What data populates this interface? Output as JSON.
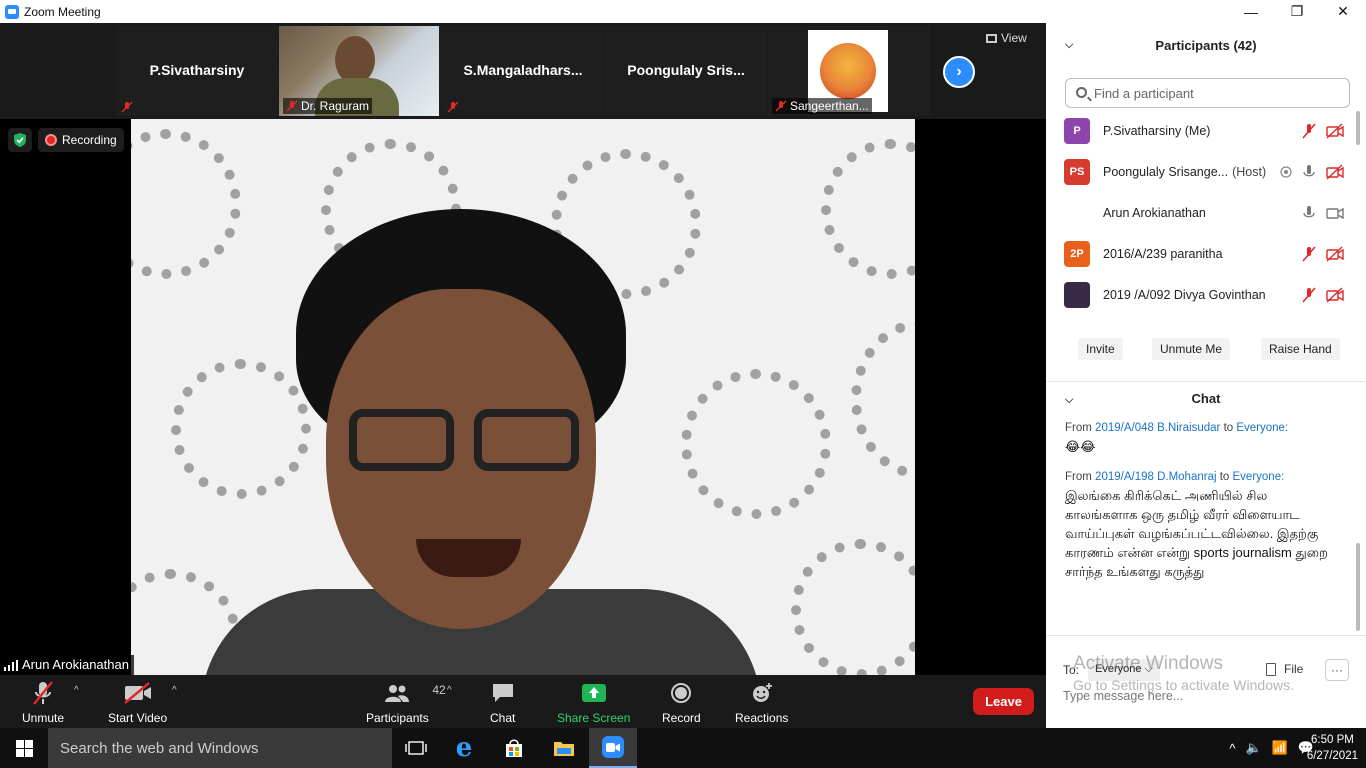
{
  "window": {
    "title": "Zoom Meeting",
    "minimize": "—",
    "maximize": "❐",
    "close": "✕"
  },
  "thumbnails": [
    {
      "name": "P.Sivatharsiny"
    },
    {
      "name": "Dr. Raguram"
    },
    {
      "name": "S.Mangaladhars..."
    },
    {
      "name": "Poongulaly  Sris..."
    },
    {
      "name": "Sangeerthan..."
    }
  ],
  "view_label": "View",
  "recording_label": "Recording",
  "active_speaker": "Arun Arokianathan",
  "toolbar": {
    "unmute": "Unmute",
    "start_video": "Start Video",
    "participants": "Participants",
    "participants_count": "42",
    "chat": "Chat",
    "share_screen": "Share Screen",
    "record": "Record",
    "reactions": "Reactions",
    "leave": "Leave"
  },
  "participants_panel": {
    "title": "Participants (42)",
    "search_placeholder": "Find a participant",
    "list": [
      {
        "initials": "P",
        "name": "P.Sivatharsiny (Me)",
        "avatar_color": "#8e44ad",
        "host": ""
      },
      {
        "initials": "PS",
        "name": "Poongulaly Srisange...",
        "avatar_color": "#d63b2f",
        "host": "(Host)"
      },
      {
        "initials": "",
        "name": "Arun Arokianathan",
        "avatar_color": "#ffffff",
        "host": ""
      },
      {
        "initials": "2P",
        "name": "2016/A/239 paranitha",
        "avatar_color": "#e8601c",
        "host": ""
      },
      {
        "initials": "",
        "name": "2019 /A/092 Divya Govinthan",
        "avatar_color": "#3a2a4a",
        "host": ""
      }
    ],
    "buttons": {
      "invite": "Invite",
      "unmute_me": "Unmute Me",
      "raise_hand": "Raise Hand"
    }
  },
  "chat_panel": {
    "title": "Chat",
    "messages": [
      {
        "from_prefix": "From",
        "sender": "2019/A/048 B.Niraisudar",
        "to_word": "to",
        "recipient": "Everyone:",
        "body": "😂😂"
      },
      {
        "from_prefix": "From",
        "sender": "2019/A/198 D.Mohanraj",
        "to_word": "to",
        "recipient": "Everyone:",
        "body": "இலங்கை கிரிக்கெட் அணியில் சில காலங்களாக ஒரு தமிழ் வீரர் விளையாட வாய்ப்புகள் வழங்கப்பட்டவில்லை.  இதற்கு காரணம் என்ன என்று sports journalism துறை சார்ந்த உங்களது கருத்து"
      }
    ],
    "to_label": "To:",
    "to_value": "Everyone",
    "file_label": "File",
    "more_label": "···",
    "input_placeholder": "Type message here...",
    "watermark_title": "Activate Windows",
    "watermark_sub": "Go to Settings to activate Windows."
  },
  "taskbar": {
    "search_placeholder": "Search the web and Windows",
    "time": "6:50 PM",
    "date": "6/27/2021"
  }
}
